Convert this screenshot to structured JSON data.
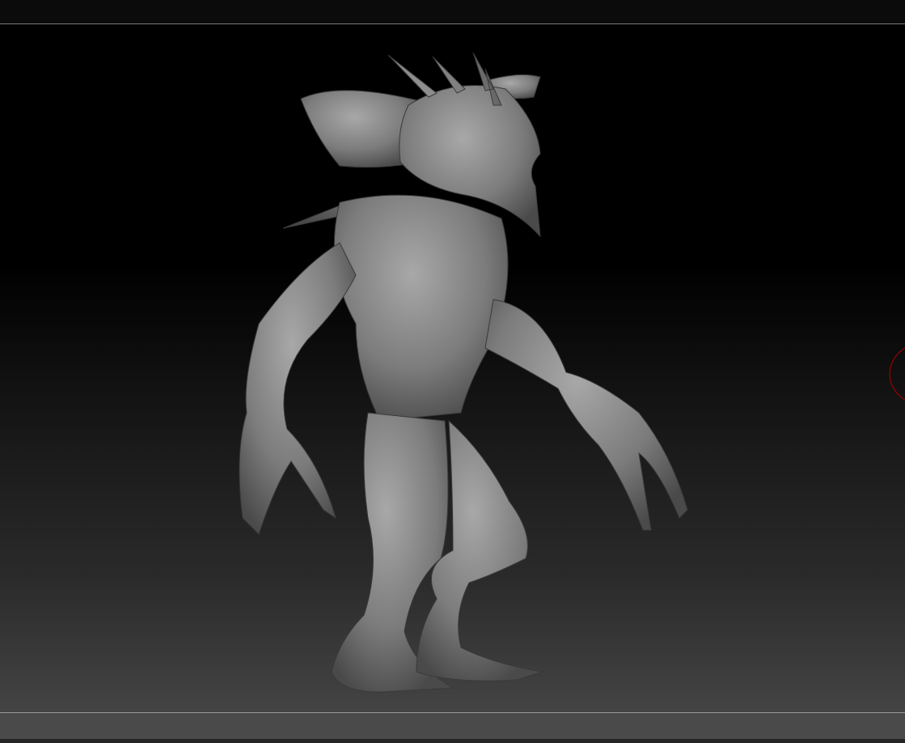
{
  "viewport": {
    "model": "creature-sculpt",
    "colors": {
      "background_top": "#000000",
      "background_bottom": "#444444",
      "model": "#8a8a8a",
      "brush_cursor": "#b00000"
    }
  }
}
